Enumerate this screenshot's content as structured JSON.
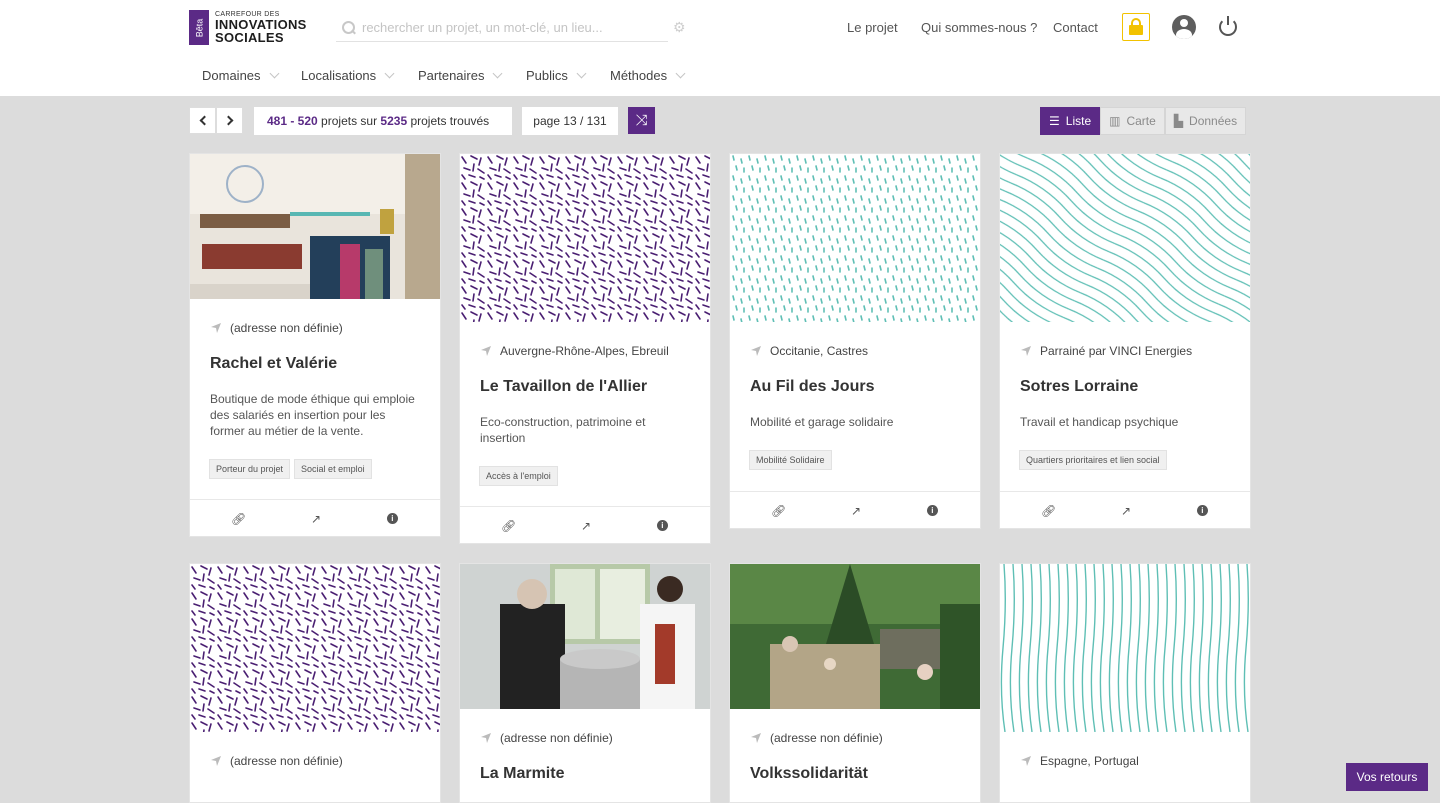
{
  "header": {
    "beta": "Bêta",
    "logo_small": "CARREFOUR DES",
    "logo_line1": "INNOVATIONS",
    "logo_line2": "SOCIALES",
    "search_placeholder": "rechercher un projet, un mot-clé, un lieu...",
    "nav": [
      "Le projet",
      "Qui sommes-nous ?",
      "Contact"
    ],
    "icons": [
      "search-icon",
      "gear-icon",
      "lock-icon",
      "user-avatar-icon",
      "power-icon"
    ]
  },
  "menu": [
    "Domaines",
    "Localisations",
    "Partenaires",
    "Publics",
    "Méthodes"
  ],
  "toolbar": {
    "range": "481 - 520",
    "range_mid": " projets sur ",
    "total": "5235",
    "range_end": " projets trouvés",
    "page": "page 13 / 131",
    "views": [
      "Liste",
      "Carte",
      "Données"
    ]
  },
  "colors": {
    "brand": "#5b2a86",
    "teal": "#5fbfb5",
    "lock": "#f2c200"
  },
  "cards": [
    {
      "location": "(adresse non définie)",
      "title": "Rachel et Valérie",
      "desc": "Boutique de mode éthique qui emploie des salariés en insertion pour les former au métier de la vente.",
      "tags": [
        "Porteur du projet",
        "Social et emploi"
      ],
      "image": "photo-shop"
    },
    {
      "location": "Auvergne-Rhône-Alpes, Ebreuil",
      "title": "Le Tavaillon de l'Allier",
      "desc": "Eco-construction, patrimoine et insertion",
      "tags": [
        "Accès à l'emploi"
      ],
      "image": "pattern-purple-dashes"
    },
    {
      "location": "Occitanie, Castres",
      "title": "Au Fil des Jours",
      "desc": "Mobilité et garage solidaire",
      "tags": [
        "Mobilité Solidaire"
      ],
      "image": "pattern-teal-dots"
    },
    {
      "location": "Parrainé par VINCI Energies",
      "title": "Sotres Lorraine",
      "desc": "Travail et handicap psychique",
      "tags": [
        "Quartiers prioritaires et lien social"
      ],
      "image": "pattern-teal-waves"
    },
    {
      "location": "(adresse non définie)",
      "title": "",
      "image": "pattern-purple-dashes"
    },
    {
      "location": "(adresse non définie)",
      "title": "La Marmite",
      "image": "photo-kitchen"
    },
    {
      "location": "(adresse non définie)",
      "title": "Volkssolidarität",
      "image": "photo-park"
    },
    {
      "location": "Espagne, Portugal",
      "title": "",
      "image": "pattern-teal-lines"
    }
  ],
  "feedback": "Vos retours"
}
